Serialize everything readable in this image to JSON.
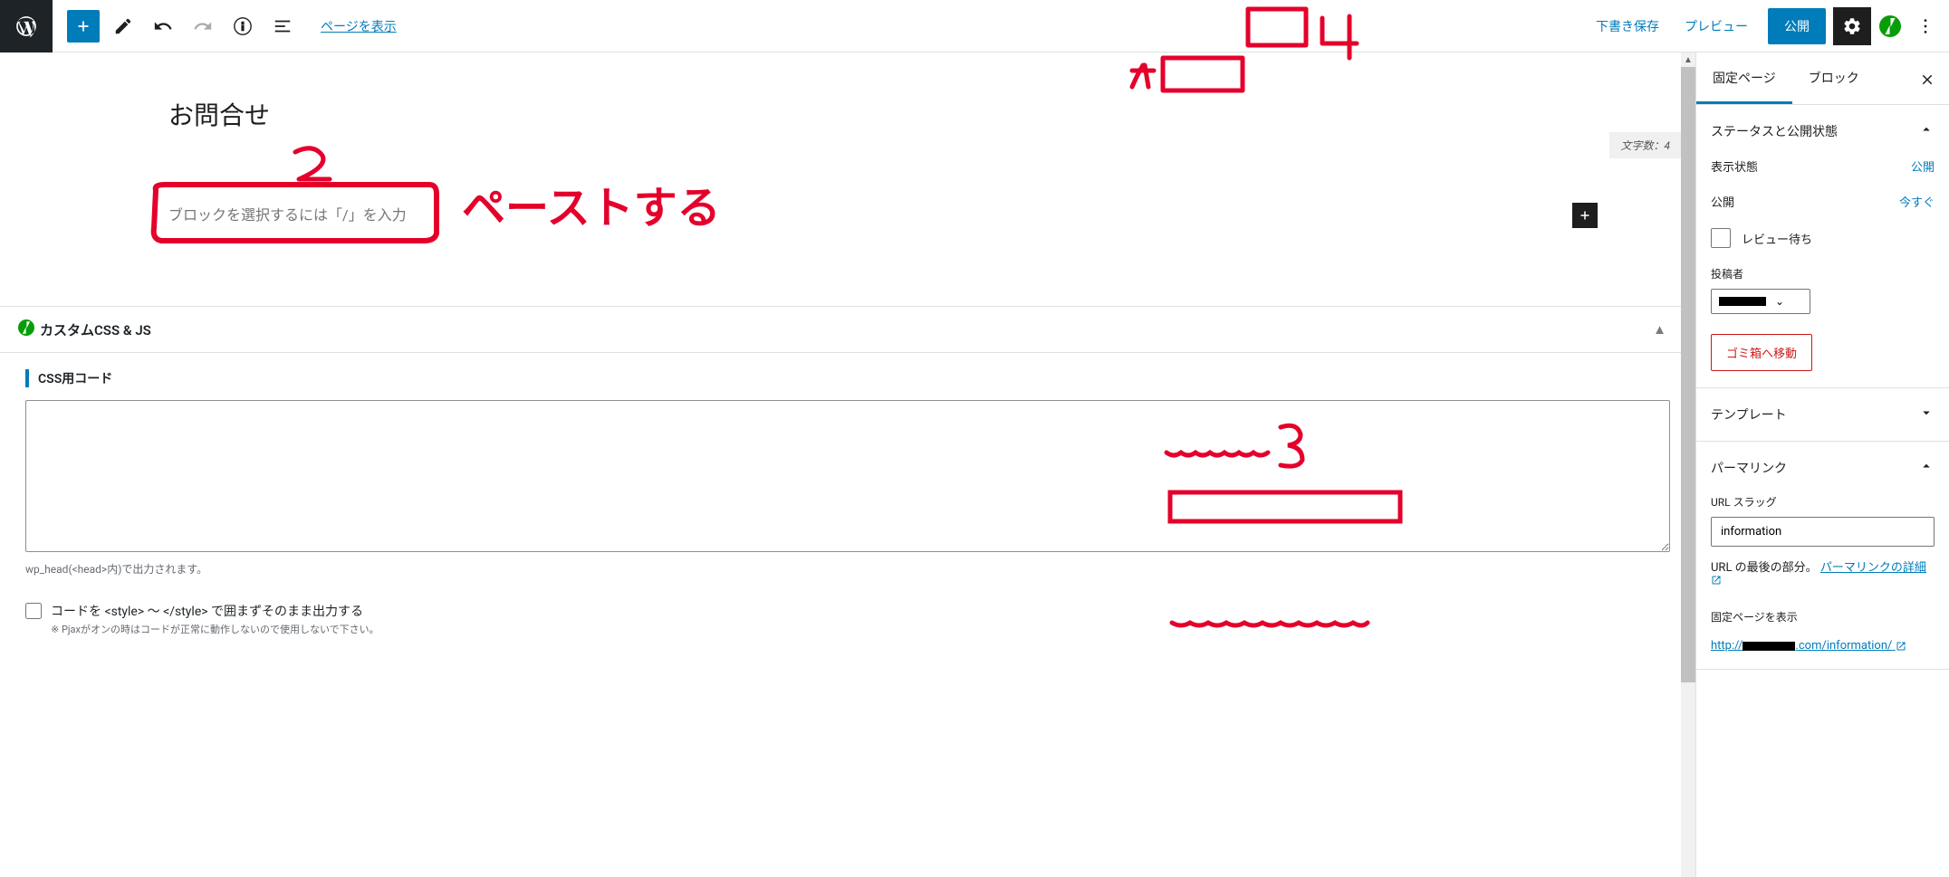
{
  "toolbar": {
    "view_page": "ページを表示",
    "save_draft": "下書き保存",
    "preview": "プレビュー",
    "publish": "公開"
  },
  "editor": {
    "title": "お問合せ",
    "word_count_label": "文字数：4",
    "block_placeholder": "ブロックを選択するには「/」を入力"
  },
  "metabox": {
    "title": "カスタムCSS & JS",
    "css_label": "CSS用コード",
    "css_help": "wp_head(<head>内)で出力されます。",
    "raw_checkbox": "コードを <style> ～ </style> で囲まずそのまま出力する",
    "raw_note": "※ Pjaxがオンの時はコードが正常に動作しないので使用しないで下さい。"
  },
  "sidebar": {
    "tab_page": "固定ページ",
    "tab_block": "ブロック",
    "panels": {
      "status": {
        "title": "ステータスと公開状態",
        "visibility_label": "表示状態",
        "visibility_value": "公開",
        "publish_label": "公開",
        "publish_value": "今すぐ",
        "pending_review": "レビュー待ち",
        "author_label": "投稿者",
        "trash": "ゴミ箱へ移動"
      },
      "template": {
        "title": "テンプレート"
      },
      "permalink": {
        "title": "パーマリンク",
        "slug_label": "URL スラッグ",
        "slug_value": "information",
        "slug_help_1": "URL の最後の部分。 ",
        "slug_help_link": "パーマリンクの詳細",
        "view_label": "固定ページを表示",
        "url_prefix": "http://",
        "url_mid": ".com/",
        "url_suffix": "information/"
      }
    }
  },
  "annotations": {
    "n1": "1",
    "n2": "2",
    "n3": "3",
    "n4": "4",
    "paste": "ペーストする"
  }
}
